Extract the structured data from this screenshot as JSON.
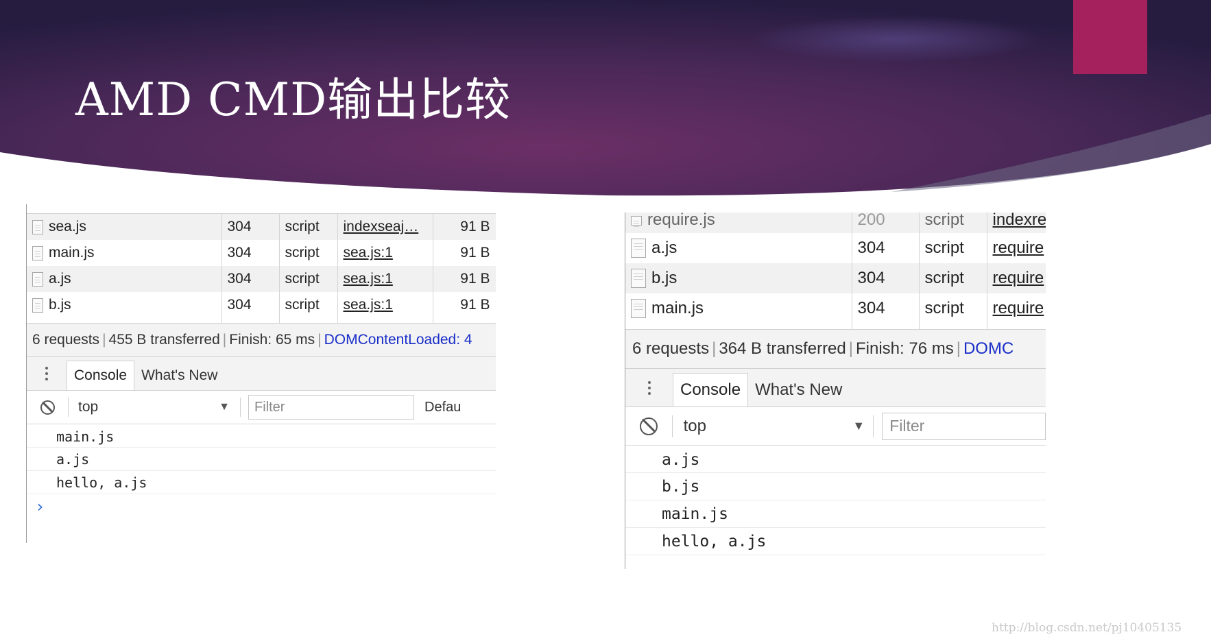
{
  "slide": {
    "title": "AMD  CMD输出比较",
    "watermark": "http://blog.csdn.net/pj10405135",
    "accent_color": "#a5215d",
    "banner_colors": [
      "#2e1f4e",
      "#6b2f66",
      "#3a2a5a"
    ]
  },
  "left_panel": {
    "network_rows": [
      {
        "name": "sea.js",
        "status": "304",
        "type": "script",
        "initiator": "indexseaj…",
        "size": "91 B"
      },
      {
        "name": "main.js",
        "status": "304",
        "type": "script",
        "initiator": "sea.js:1",
        "size": "91 B"
      },
      {
        "name": "a.js",
        "status": "304",
        "type": "script",
        "initiator": "sea.js:1",
        "size": "91 B"
      },
      {
        "name": "b.js",
        "status": "304",
        "type": "script",
        "initiator": "sea.js:1",
        "size": "91 B"
      }
    ],
    "summary": {
      "requests": "6 requests",
      "transferred": "455 B transferred",
      "finish": "Finish: 65 ms",
      "dom": "DOMContentLoaded: 4"
    },
    "tabs": {
      "console": "Console",
      "whats_new": "What's New"
    },
    "toolbar": {
      "context": "top",
      "filter_placeholder": "Filter",
      "levels": "Defau"
    },
    "console_lines": [
      "main.js",
      "a.js",
      "hello, a.js"
    ],
    "prompt": "›"
  },
  "right_panel": {
    "network_rows": [
      {
        "name": "require.js",
        "status": "200",
        "type": "script",
        "initiator": "indexre"
      },
      {
        "name": "a.js",
        "status": "304",
        "type": "script",
        "initiator": "require"
      },
      {
        "name": "b.js",
        "status": "304",
        "type": "script",
        "initiator": "require"
      },
      {
        "name": "main.js",
        "status": "304",
        "type": "script",
        "initiator": "require"
      }
    ],
    "summary": {
      "requests": "6 requests",
      "transferred": "364 B transferred",
      "finish": "Finish: 76 ms",
      "dom": "DOMC"
    },
    "tabs": {
      "console": "Console",
      "whats_new": "What's New"
    },
    "toolbar": {
      "context": "top",
      "filter_placeholder": "Filter"
    },
    "console_lines": [
      "a.js",
      "b.js",
      "main.js",
      "hello, a.js"
    ]
  }
}
